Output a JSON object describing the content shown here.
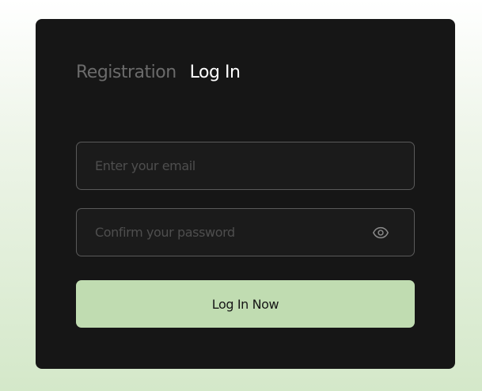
{
  "tabs": {
    "registration": "Registration",
    "login": "Log In",
    "active": "login"
  },
  "form": {
    "email_placeholder": "Enter your email",
    "email_value": "",
    "password_placeholder": "Confirm your password",
    "password_value": "",
    "password_toggle_icon": "eye-icon",
    "submit_label": "Log In Now"
  },
  "colors": {
    "card_background": "#161616",
    "accent": "#c0dcb1",
    "inactive_tab": "#6b6b6b",
    "active_tab": "#ffffff",
    "field_border": "#5a5a5a"
  }
}
